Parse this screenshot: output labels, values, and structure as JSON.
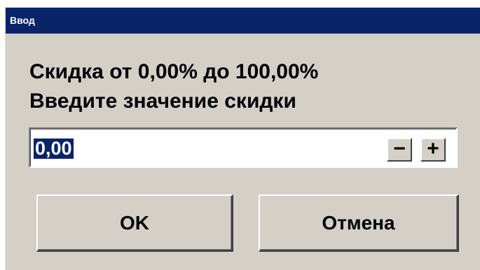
{
  "window": {
    "title": "Ввод"
  },
  "prompt": {
    "line1": "Скидка от 0,00% до 100,00%",
    "line2": "Введите значение скидки"
  },
  "input": {
    "value": "0,00"
  },
  "stepper": {
    "minus_label": "−",
    "plus_label": "+"
  },
  "buttons": {
    "ok_label": "OK",
    "cancel_label": "Отмена"
  },
  "colors": {
    "titlebar": "#0a246a",
    "face": "#d4d0c8",
    "selection": "#0a246a"
  }
}
